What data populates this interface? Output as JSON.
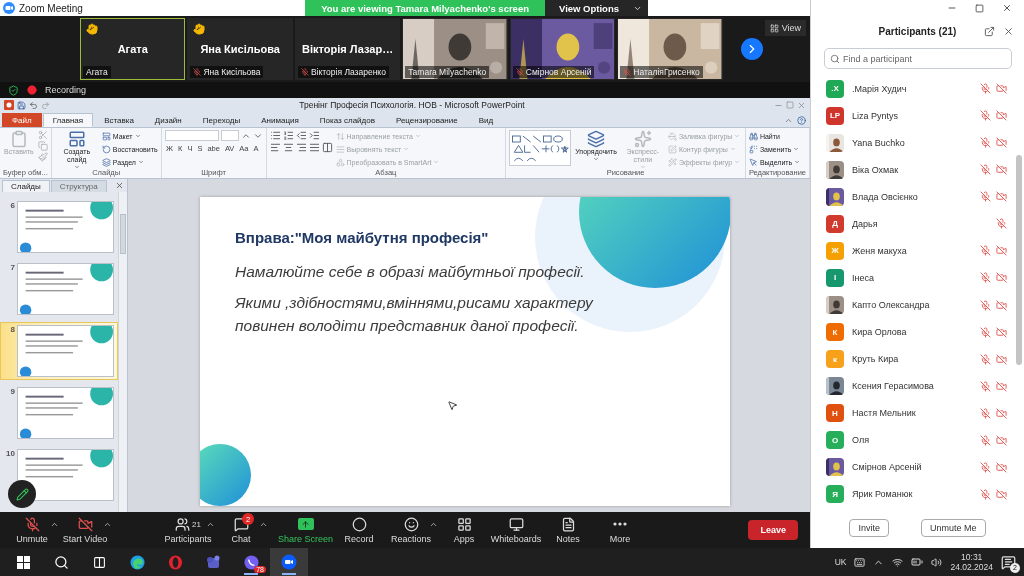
{
  "window": {
    "title": "Zoom Meeting"
  },
  "share_banner": {
    "text": "You are viewing Tamara Milyachenko's screen",
    "button": "View Options"
  },
  "video_tiles": [
    {
      "kind": "name",
      "display_name": "Агата",
      "label": "Агата",
      "hand_raised": true,
      "muted": false,
      "highlighted": true
    },
    {
      "kind": "name",
      "display_name": "Яна Кисільова",
      "label": "Яна Кисільова",
      "hand_raised": true,
      "muted": true,
      "highlighted": false
    },
    {
      "kind": "name",
      "display_name": "Вікторія  Лазар…",
      "label": "Вікторія Лазаренко",
      "hand_raised": false,
      "muted": true,
      "highlighted": false
    },
    {
      "kind": "video",
      "label": "Tamara Milyachenko",
      "hand_raised": false,
      "muted": false,
      "highlighted": false
    },
    {
      "kind": "video",
      "label": "Смірнов Арсеній",
      "hand_raised": false,
      "muted": true,
      "highlighted": false
    },
    {
      "kind": "video",
      "label": "НаталіяГрисенко",
      "hand_raised": false,
      "muted": true,
      "highlighted": false
    }
  ],
  "gallery": {
    "view_button": "View"
  },
  "recording": {
    "label": "Recording"
  },
  "powerpoint": {
    "title": "Тренінг Професія Психологія. НОВ  -  Microsoft PowerPoint",
    "tabs": [
      {
        "label": "Файл",
        "kind": "file",
        "selected": false
      },
      {
        "label": "Главная",
        "kind": "tab",
        "selected": true
      },
      {
        "label": "Вставка",
        "kind": "tab",
        "selected": false
      },
      {
        "label": "Дизайн",
        "kind": "tab",
        "selected": false
      },
      {
        "label": "Переходы",
        "kind": "tab",
        "selected": false
      },
      {
        "label": "Анимация",
        "kind": "tab",
        "selected": false
      },
      {
        "label": "Показ слайдов",
        "kind": "tab",
        "selected": false
      },
      {
        "label": "Рецензирование",
        "kind": "tab",
        "selected": false
      },
      {
        "label": "Вид",
        "kind": "tab",
        "selected": false
      }
    ],
    "ribbon": [
      {
        "label": "Буфер обм...",
        "items": [
          {
            "kind": "large",
            "label": "Вставить",
            "disabled": true,
            "dropdown": false
          },
          {
            "kind": "tools",
            "disabled": true
          }
        ]
      },
      {
        "label": "Слайды",
        "items": [
          {
            "kind": "large",
            "label": "Создать слайд",
            "disabled": false,
            "dropdown": true
          },
          {
            "kind": "small",
            "label": "Макет",
            "disabled": false,
            "dropdown": true
          },
          {
            "kind": "small",
            "label": "Восстановить",
            "disabled": false,
            "dropdown": false
          },
          {
            "kind": "small",
            "label": "Раздел",
            "disabled": false,
            "dropdown": true
          }
        ]
      },
      {
        "label": "Шрифт",
        "items": [
          {
            "kind": "font",
            "glyphs": [
              "Ж",
              "К",
              "Ч",
              "S",
              "abe",
              "AV",
              "Aa",
              "A"
            ]
          }
        ]
      },
      {
        "label": "Абзац",
        "items": [
          {
            "kind": "paragraph"
          },
          {
            "kind": "small",
            "label": "Направление текста",
            "disabled": true,
            "dropdown": true
          },
          {
            "kind": "small",
            "label": "Выровнять текст",
            "disabled": true,
            "dropdown": true
          },
          {
            "kind": "small",
            "label": "Преобразовать в SmartArt",
            "disabled": true,
            "dropdown": true
          }
        ]
      },
      {
        "label": "Рисование",
        "items": [
          {
            "kind": "shapes"
          },
          {
            "kind": "large",
            "label": "Упорядочить",
            "disabled": false,
            "dropdown": true
          },
          {
            "kind": "large",
            "label": "Экспресс-стили",
            "disabled": true,
            "dropdown": true
          },
          {
            "kind": "small",
            "label": "Заливка фигуры",
            "disabled": true,
            "dropdown": true
          },
          {
            "kind": "small",
            "label": "Контур фигуры",
            "disabled": true,
            "dropdown": true
          },
          {
            "kind": "small",
            "label": "Эффекты фигур",
            "disabled": true,
            "dropdown": true
          }
        ]
      },
      {
        "label": "Редактирование",
        "items": [
          {
            "kind": "small",
            "label": "Найти",
            "disabled": false,
            "dropdown": false
          },
          {
            "kind": "small",
            "label": "Заменить",
            "disabled": false,
            "dropdown": true
          },
          {
            "kind": "small",
            "label": "Выделить",
            "disabled": false,
            "dropdown": true
          }
        ]
      }
    ],
    "slides_panel": {
      "tabs": [
        {
          "label": "Слайды",
          "selected": true
        },
        {
          "label": "Структура",
          "selected": false
        }
      ],
      "thumbnails": [
        {
          "number": "6",
          "selected": false
        },
        {
          "number": "7",
          "selected": false
        },
        {
          "number": "8",
          "selected": true
        },
        {
          "number": "9",
          "selected": false
        },
        {
          "number": "10",
          "selected": false
        }
      ]
    },
    "slide": {
      "title": "Вправа:\"Моя майбутня професія\"",
      "lines": [
        "Намалюйте себе в образі майбутньої професії.",
        "Якими ,здібностями,вміннями,рисами характеру повинен володіти   представник даної професії."
      ]
    }
  },
  "toolbar": [
    {
      "label": "Unmute",
      "kind": "plain",
      "off": true,
      "menu": true
    },
    {
      "label": "Start Video",
      "kind": "plain",
      "off": true,
      "menu": true
    },
    {
      "label": "Participants",
      "kind": "plain",
      "off": false,
      "menu": true,
      "count": "21"
    },
    {
      "label": "Chat",
      "kind": "plain",
      "off": false,
      "menu": true,
      "badge": "2"
    },
    {
      "label": "Share Screen",
      "kind": "share",
      "off": false,
      "menu": false
    },
    {
      "label": "Record",
      "kind": "plain",
      "off": false,
      "menu": false
    },
    {
      "label": "Reactions",
      "kind": "plain",
      "off": false,
      "menu": true
    },
    {
      "label": "Apps",
      "kind": "plain",
      "off": false,
      "menu": false
    },
    {
      "label": "Whiteboards",
      "kind": "plain",
      "off": false,
      "menu": false
    },
    {
      "label": "Notes",
      "kind": "plain",
      "off": false,
      "menu": false
    },
    {
      "label": "More",
      "kind": "plain",
      "off": false,
      "menu": false
    }
  ],
  "leave_button": "Leave",
  "participants": {
    "title": "Participants (21)",
    "search": {
      "placeholder": "Find a participant"
    },
    "list": [
      {
        "name": ".Марія Худич",
        "kind": "initials",
        "initials": ".X",
        "color": "#1fa855",
        "video_off": true
      },
      {
        "name": "Liza Pyntys",
        "kind": "initials",
        "initials": "LP",
        "color": "#d0352b",
        "video_off": true
      },
      {
        "name": "Yana Buchko",
        "kind": "picture",
        "video_off": true
      },
      {
        "name": "Віка Охмак",
        "kind": "picture",
        "video_off": true
      },
      {
        "name": "Влада Овсієнко",
        "kind": "picture",
        "video_off": true
      },
      {
        "name": "Дарья",
        "kind": "initials",
        "initials": "Д",
        "color": "#d23a2d",
        "video_off": false
      },
      {
        "name": "Женя макуха",
        "kind": "initials",
        "initials": "Ж",
        "color": "#f5a000",
        "video_off": true
      },
      {
        "name": "Інеса",
        "kind": "initials",
        "initials": "І",
        "color": "#17976e",
        "video_off": true
      },
      {
        "name": "Капто Олександра",
        "kind": "picture",
        "video_off": true
      },
      {
        "name": "Кира Орлова",
        "kind": "initials",
        "initials": "К",
        "color": "#ef6c00",
        "video_off": true
      },
      {
        "name": "Круть Кира",
        "kind": "initials",
        "initials": "к",
        "color": "#f7a11b",
        "video_off": true
      },
      {
        "name": "Ксения Герасимова",
        "kind": "picture",
        "video_off": true
      },
      {
        "name": "Настя Мельник",
        "kind": "initials",
        "initials": "Н",
        "color": "#e0500f",
        "video_off": true
      },
      {
        "name": "Оля",
        "kind": "initials",
        "initials": "О",
        "color": "#27ae5a",
        "video_off": true
      },
      {
        "name": "Смірнов Арсеній",
        "kind": "picture",
        "video_off": true
      },
      {
        "name": "Ярик Романюк",
        "kind": "initials",
        "initials": "Я",
        "color": "#27ae5a",
        "video_off": true
      }
    ],
    "buttons": [
      "Invite",
      "Unmute Me"
    ]
  },
  "taskbar": {
    "apps": [
      {
        "running": false,
        "selected": false
      },
      {
        "running": false,
        "selected": false
      },
      {
        "running": false,
        "selected": false
      },
      {
        "running": false,
        "selected": false
      },
      {
        "running": false,
        "selected": false
      },
      {
        "running": false,
        "selected": false
      },
      {
        "running": true,
        "selected": false,
        "badge": "78"
      },
      {
        "running": true,
        "selected": true
      }
    ],
    "language": "UK",
    "time": "10:31",
    "date": "24.02.2024",
    "notifications": "2"
  }
}
